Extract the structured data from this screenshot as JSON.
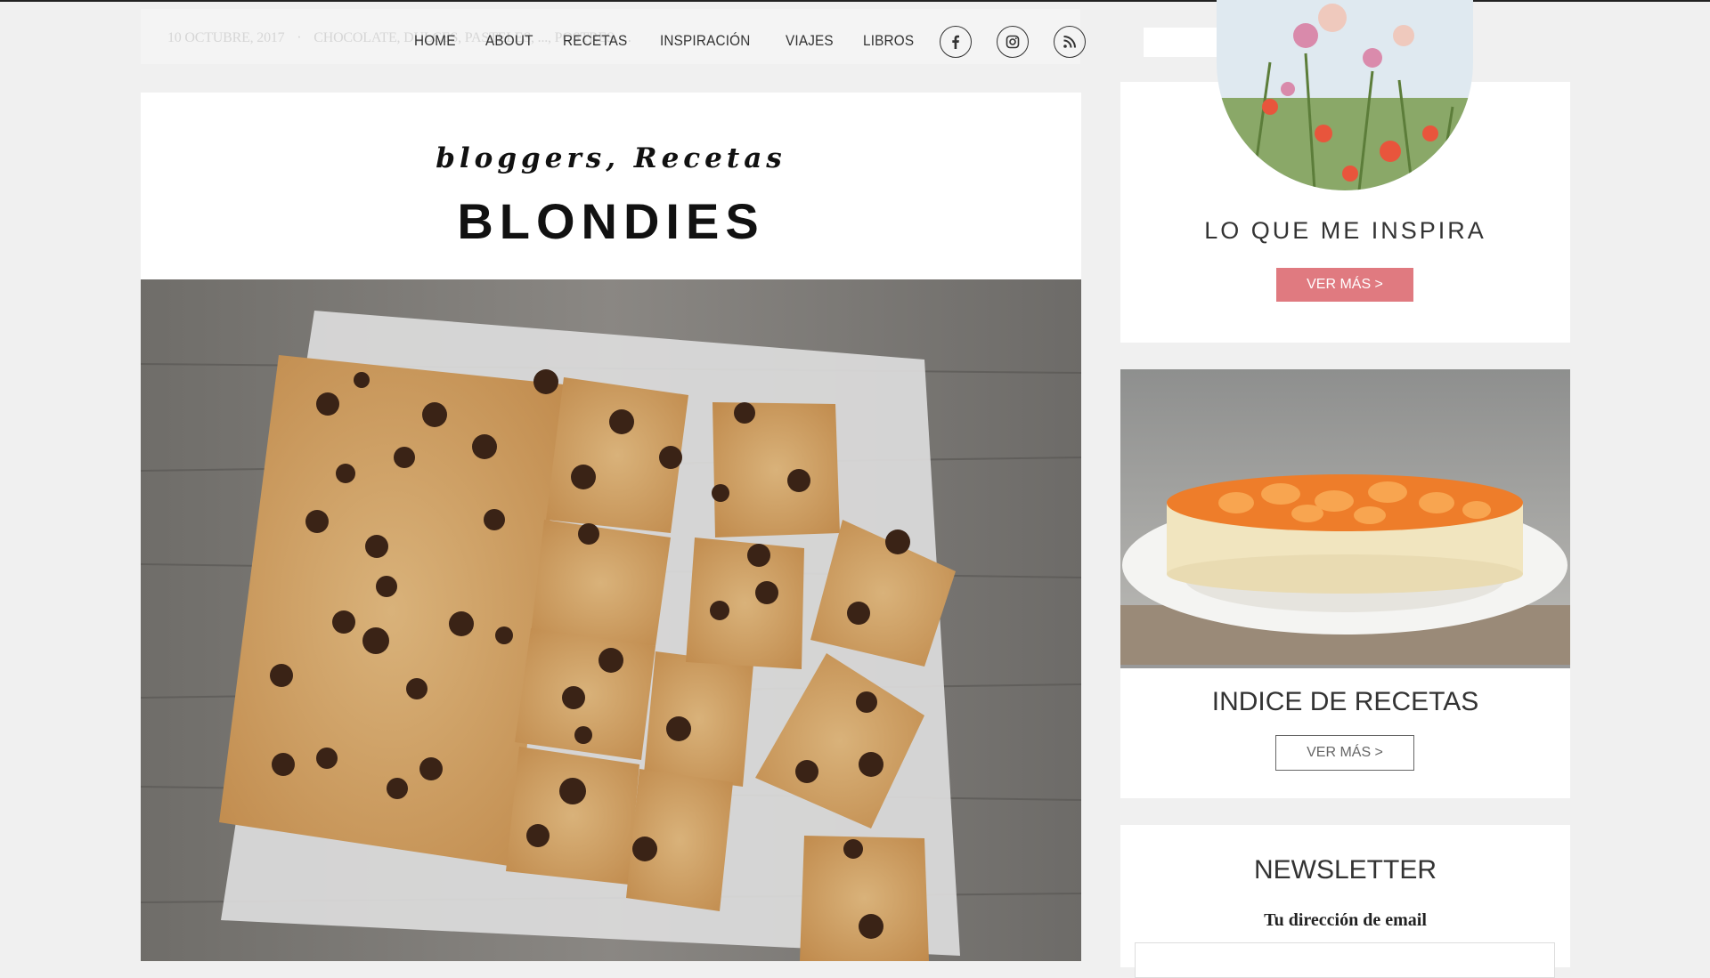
{
  "header": {
    "meta_ghost": {
      "date": "10 OCTUBRE, 2017",
      "categories": "CHOCOLATE, DULCES, PASTELES, ..., POSTRES, ..."
    },
    "nav": [
      "HOME",
      "ABOUT",
      "RECETAS",
      "INSPIRACIÓN",
      "VIAJES",
      "LIBROS"
    ],
    "social_icons": [
      "facebook-icon",
      "instagram-icon",
      "rss-icon"
    ],
    "search": {
      "placeholder": "",
      "value": ""
    }
  },
  "post": {
    "categories": "bloggers, Recetas",
    "title": "BLONDIES",
    "image": "blondies cut into squares on parchment paper over wood"
  },
  "sidebar": {
    "inspira": {
      "title": "LO QUE ME INSPIRA",
      "button": "VER MÁS >"
    },
    "indice": {
      "title": "INDICE DE RECETAS",
      "button": "VER MÁS >"
    },
    "newsletter": {
      "title": "NEWSLETTER",
      "email_label": "Tu dirección de email",
      "email_value": ""
    }
  },
  "colors": {
    "accent": "#e07a80",
    "text": "#333333",
    "page_bg": "#f0f0f0"
  }
}
